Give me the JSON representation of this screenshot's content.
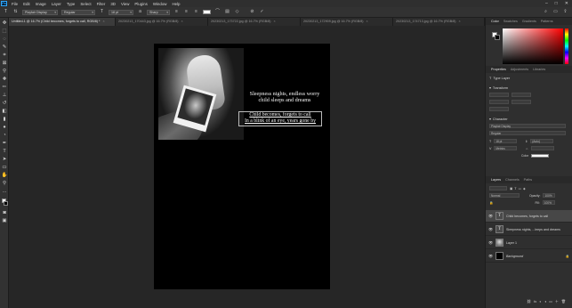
{
  "menubar": {
    "logo": "Ps",
    "items": [
      "File",
      "Edit",
      "Image",
      "Layer",
      "Type",
      "Select",
      "Filter",
      "3D",
      "View",
      "Plugins",
      "Window",
      "Help"
    ],
    "window_buttons": [
      "–",
      "□",
      "✕"
    ]
  },
  "options": {
    "font_family": "Playfair Display",
    "font_style": "Regular",
    "font_size": "18 pt",
    "antialias": "Sharp",
    "commit_label": "✓",
    "cancel_label": "⊘",
    "text_color": "#ffffff"
  },
  "tabs": [
    {
      "label": "Untitled-1 @ 16.7% (Child becomes, forgets to call, RGB/8) *",
      "active": true
    },
    {
      "label": "20230213_170443.jpg @ 16.7% (RGB/8)",
      "active": false
    },
    {
      "label": "20230213_173722.jpg @ 16.7% (RGB/8)",
      "active": false
    },
    {
      "label": "20230213_172909.jpg @ 16.7% (RGB/8)",
      "active": false
    },
    {
      "label": "20230213_174713.jpg @ 16.7% (RGB/8)",
      "active": false
    }
  ],
  "canvas": {
    "heading_lines": [
      "Sleepness nights, endless worry",
      "child sleeps and dreams"
    ],
    "body_lines": [
      "Child becomes, forgets to call",
      "In a blink of an eye, years gone by"
    ]
  },
  "color_panel": {
    "tabs": [
      {
        "label": "Color",
        "active": true
      },
      {
        "label": "Swatches",
        "active": false
      },
      {
        "label": "Gradients",
        "active": false
      },
      {
        "label": "Patterns",
        "active": false
      }
    ],
    "foreground": "#ffffff",
    "background": "#000000"
  },
  "properties_panel": {
    "tabs": [
      {
        "label": "Properties",
        "active": true
      },
      {
        "label": "Adjustments",
        "active": false
      },
      {
        "label": "Libraries",
        "active": false
      }
    ],
    "type_label": "Type Layer",
    "transform_label": "Transform",
    "character_label": "Character",
    "character": {
      "font": "Playfair Display",
      "style": "Regular",
      "size": "18 pt",
      "leading": "(Auto)",
      "tracking": "Metrics",
      "color_label": "Color"
    }
  },
  "layers_panel": {
    "tabs": [
      {
        "label": "Layers",
        "active": true
      },
      {
        "label": "Channels",
        "active": false
      },
      {
        "label": "Paths",
        "active": false
      }
    ],
    "blend_mode": "Normal",
    "opacity_label": "Opacity:",
    "opacity": "100%",
    "fill_label": "Fill:",
    "fill": "100%",
    "layers": [
      {
        "name": "Child becomes, forgets to call",
        "kind": "text",
        "active": true
      },
      {
        "name": "Sleepness nights, ...leeps and dreams",
        "kind": "text",
        "active": false
      },
      {
        "name": "Layer 1",
        "kind": "image",
        "active": false
      },
      {
        "name": "Background",
        "kind": "black",
        "active": false
      }
    ]
  }
}
